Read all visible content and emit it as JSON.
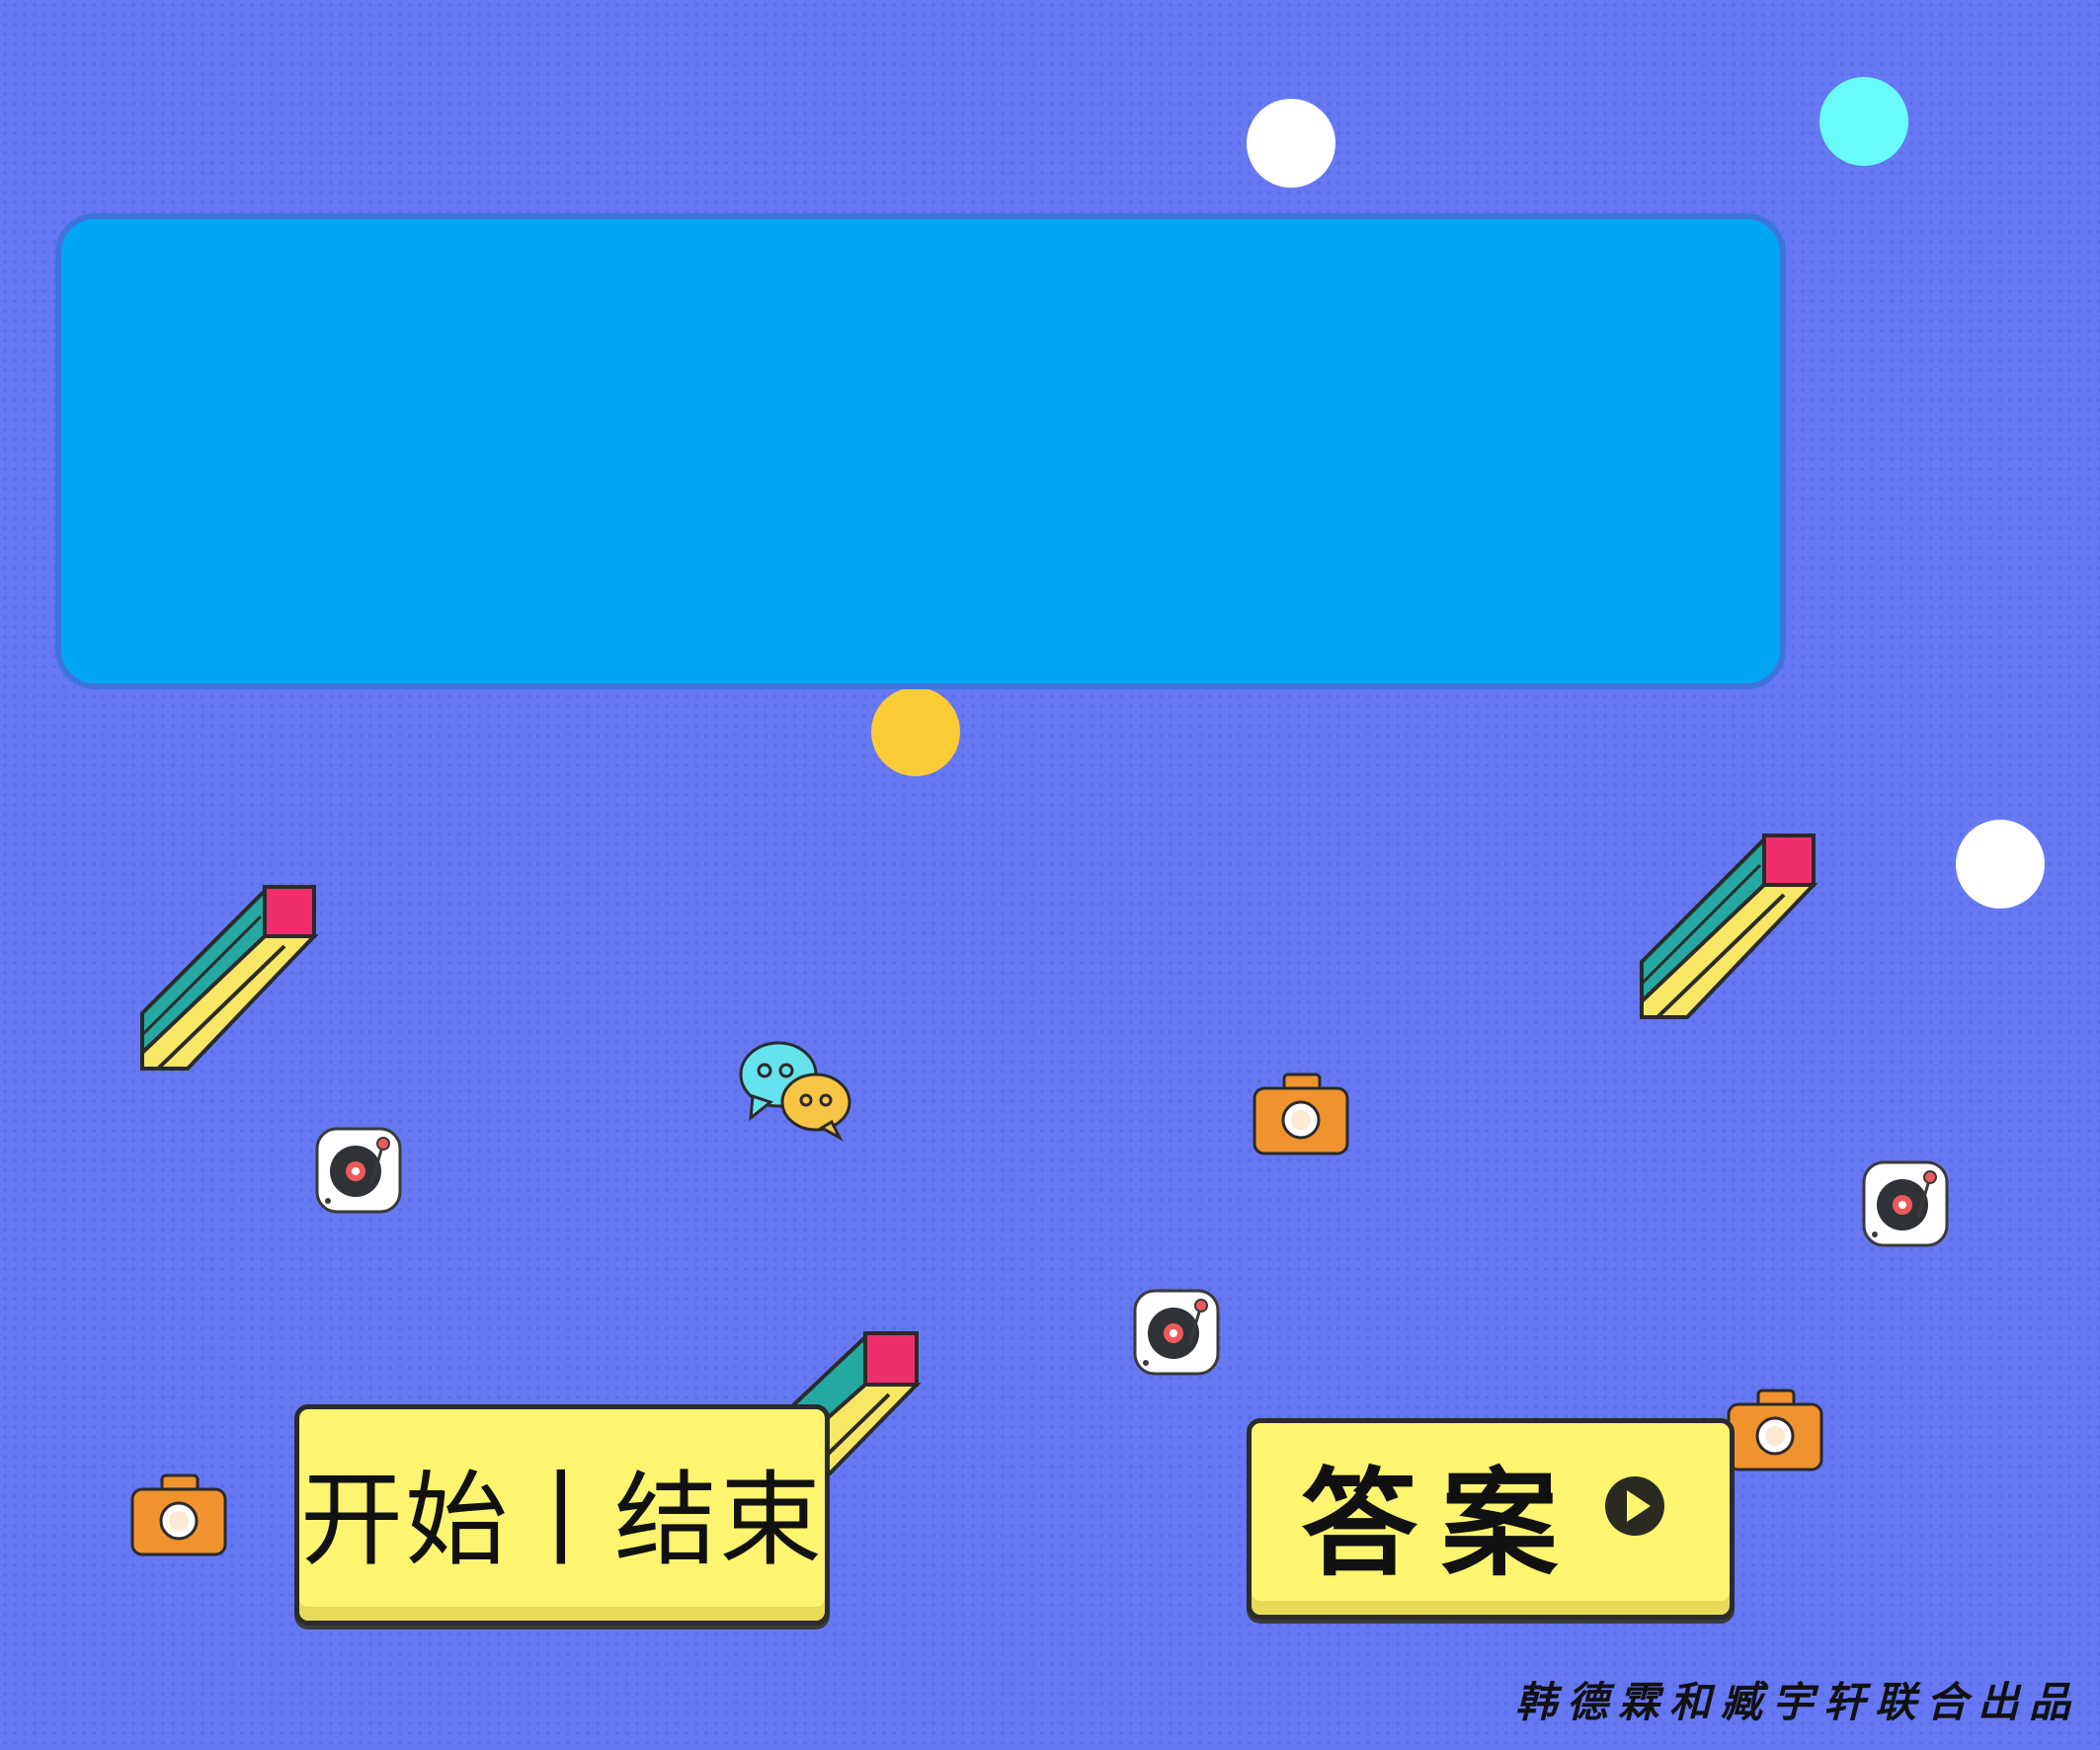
{
  "game": {
    "start_end_label": "开始丨结束",
    "answer_label": "答案",
    "credit": "韩德霖和臧宇轩联合出品"
  },
  "question_panel": {
    "text": ""
  },
  "icons": {
    "play": "play-circle-icon",
    "pencil": "pencil-icon",
    "turntable": "turntable-icon",
    "camera": "camera-icon",
    "chat": "chat-bubbles-icon"
  },
  "colors": {
    "background": "#6678f2",
    "panel": "#00a6f3",
    "panel_border": "#3f74db",
    "button": "#fdf46f",
    "dot_white": "#ffffff",
    "dot_cyan": "#67fbfb",
    "dot_yellow": "#fbcc35"
  }
}
